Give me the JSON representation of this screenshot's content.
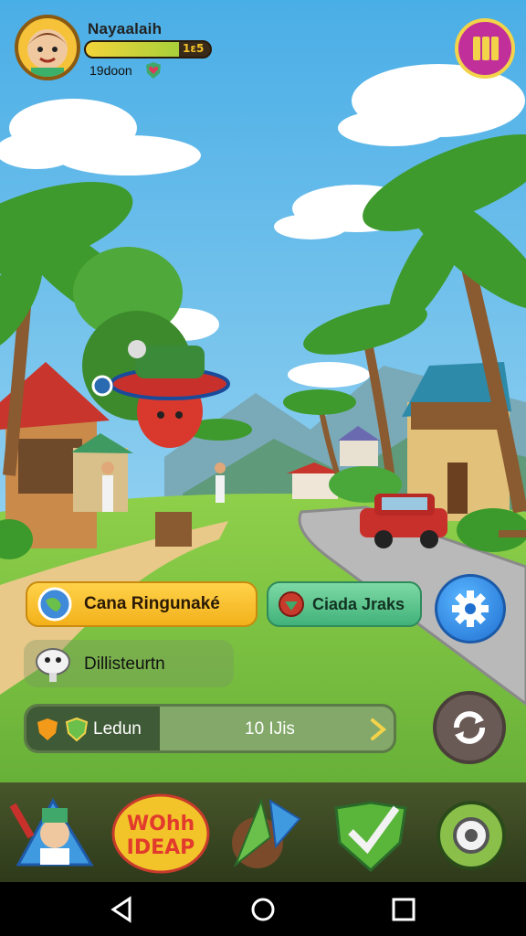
{
  "hud": {
    "player_name": "Nayaalaih",
    "xp_text": "1ɛ5",
    "xp_progress": 0.75,
    "coins": "19doon",
    "avatar_icon": "player-avatar-icon",
    "menu_icon": "pause-menu-icon"
  },
  "actions": {
    "primary_label": "Cana Ringunaké",
    "secondary_label": "Ciada Jraks",
    "info_label": "Dillisteurtn",
    "level_label": "Ledun",
    "level_value": "10 IJis"
  },
  "bottom_nav": [
    "character-icon",
    "event-logo-icon",
    "arrows-icon",
    "checkmark-shield-icon",
    "gear-badge-icon"
  ],
  "event_logo_text": [
    "WOhh",
    "IDEAP"
  ],
  "colors": {
    "primary_button": "#f3b11b",
    "secondary_button": "#41b27a",
    "settings_button": "#1f6fd1",
    "menu_button": "#c02f9a"
  }
}
